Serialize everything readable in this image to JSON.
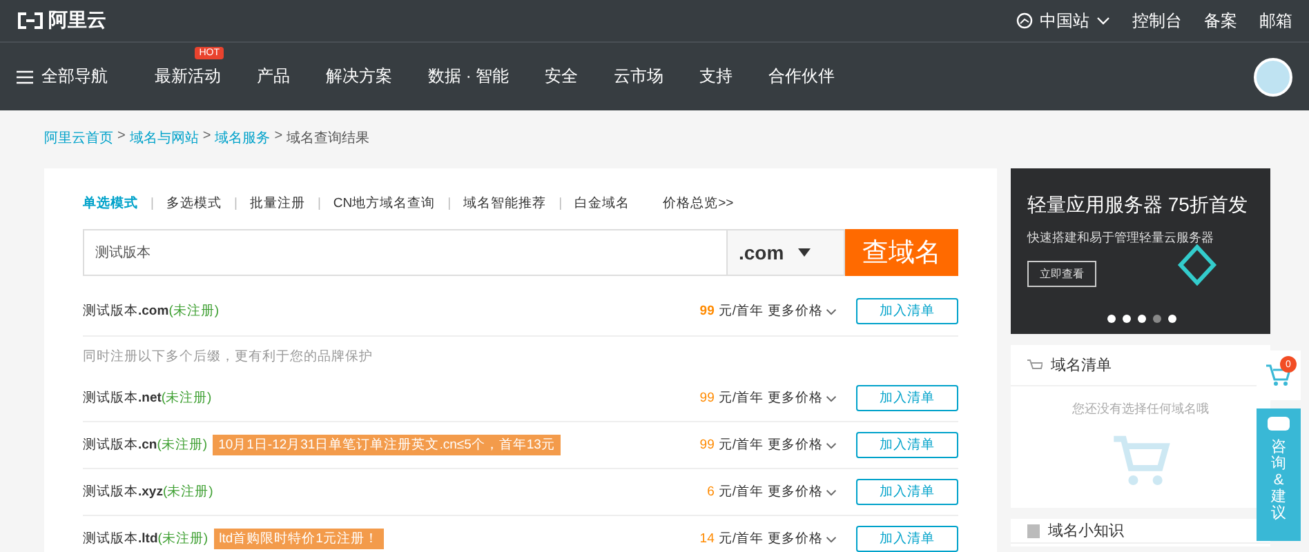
{
  "topbar": {
    "logo_text": "阿里云",
    "region": "中国站",
    "links": [
      "控制台",
      "备案",
      "邮箱"
    ]
  },
  "nav": {
    "menu_label": "全部导航",
    "items": [
      {
        "label": "最新活动",
        "badge": "HOT"
      },
      {
        "label": "产品"
      },
      {
        "label": "解决方案"
      },
      {
        "label": "数据 · 智能"
      },
      {
        "label": "安全"
      },
      {
        "label": "云市场"
      },
      {
        "label": "支持"
      },
      {
        "label": "合作伙伴"
      }
    ]
  },
  "breadcrumb_separator": ">",
  "breadcrumb": [
    {
      "label": "阿里云首页",
      "link": true
    },
    {
      "label": "域名与网站",
      "link": true
    },
    {
      "label": "域名服务",
      "link": true
    },
    {
      "label": "域名查询结果",
      "link": false
    }
  ],
  "search": {
    "modes": [
      {
        "label": "单选模式",
        "selected": true
      },
      {
        "label": "多选模式",
        "selected": false
      },
      {
        "label": "批量注册",
        "selected": false
      },
      {
        "label": "CN地方域名查询",
        "selected": false
      },
      {
        "label": "域名智能推荐",
        "selected": false
      },
      {
        "label": "白金域名",
        "selected": false
      }
    ],
    "mode_separator": "|",
    "price_link": "价格总览>>",
    "value": "测试版本",
    "suffix": ".com",
    "button": "查域名"
  },
  "results": [
    {
      "kind": "domain",
      "name": "测试版本",
      "tld": ".com",
      "status": "(未注册)",
      "price": "99",
      "unit": "元/首年",
      "more": "更多价格",
      "button": "加入清单"
    },
    {
      "kind": "hint",
      "text": "同时注册以下多个后缀，更有利于您的品牌保护"
    },
    {
      "kind": "domain",
      "name": "测试版本",
      "tld": ".net",
      "status": "(未注册)",
      "price": "99",
      "unit": "元/首年",
      "more": "更多价格",
      "button": "加入清单"
    },
    {
      "kind": "domain",
      "name": "测试版本",
      "tld": ".cn",
      "status": "(未注册)",
      "promo": "10月1日-12月31日单笔订单注册英文.cn≤5个，首年13元",
      "price": "99",
      "unit": "元/首年",
      "more": "更多价格",
      "button": "加入清单"
    },
    {
      "kind": "domain",
      "name": "测试版本",
      "tld": ".xyz",
      "status": "(未注册)",
      "price": "6",
      "unit": "元/首年",
      "more": "更多价格",
      "button": "加入清单"
    },
    {
      "kind": "domain",
      "name": "测试版本",
      "tld": ".ltd",
      "status": "(未注册)",
      "promo": "ltd首购限时特价1元注册！",
      "price": "14",
      "unit": "元/首年",
      "more": "更多价格",
      "button": "加入清单"
    }
  ],
  "banner": {
    "title": "轻量应用服务器 75折首发",
    "subtitle": "快速搭建和易于管理轻量云服务器",
    "button": "立即查看",
    "dots": [
      {
        "selected": false
      },
      {
        "selected": false
      },
      {
        "selected": false
      },
      {
        "selected": true
      },
      {
        "selected": false
      }
    ]
  },
  "cart_panel": {
    "title": "域名清单",
    "empty_text": "您还没有选择任何域名哦"
  },
  "tips_panel": {
    "title": "域名小知识"
  },
  "float": {
    "cart_count": "0",
    "consult": "咨询&建议"
  }
}
